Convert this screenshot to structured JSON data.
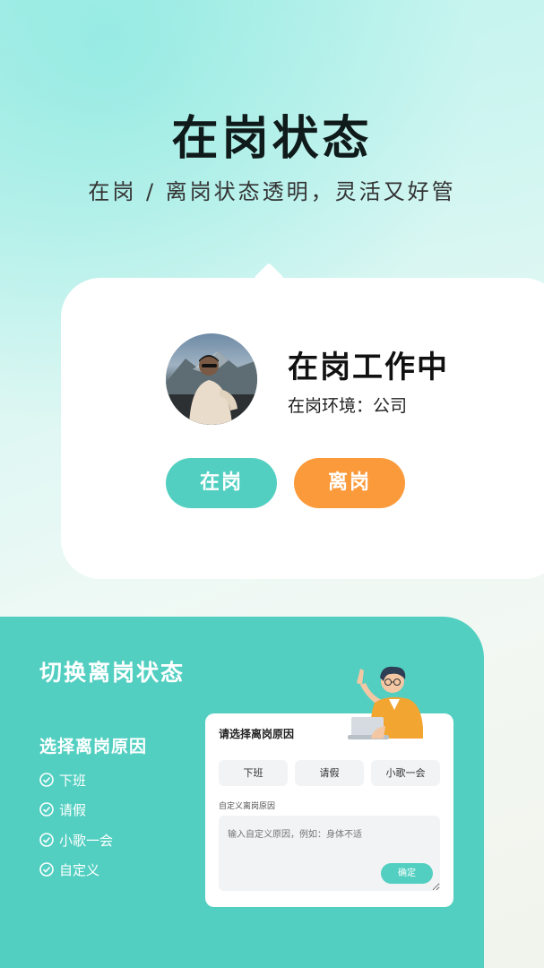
{
  "hero": {
    "title": "在岗状态",
    "subtitle": "在岗 / 离岗状态透明，灵活又好管"
  },
  "status_card": {
    "title": "在岗工作中",
    "environment": "在岗环境：公司",
    "on_button": "在岗",
    "off_button": "离岗"
  },
  "panel": {
    "title": "切换离岗状态",
    "reasons_title": "选择离岗原因",
    "reasons": [
      "下班",
      "请假",
      "小歌一会",
      "自定义"
    ]
  },
  "dialog": {
    "title": "请选择离岗原因",
    "options": [
      "下班",
      "请假",
      "小歌一会"
    ],
    "custom_label": "自定义离岗原因",
    "custom_placeholder": "输入自定义原因，例如：身体不适",
    "confirm": "确定"
  },
  "colors": {
    "teal": "#52cfc1",
    "orange": "#fb9a3b",
    "text_dark": "#111111"
  }
}
